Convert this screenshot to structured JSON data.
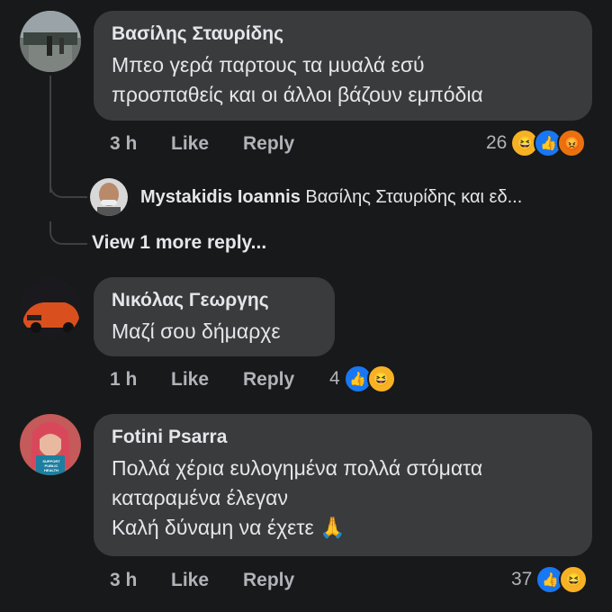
{
  "comments": [
    {
      "author": "Βασίλης Σταυρίδης",
      "text": "Μπεο γερά παρτους τα μυαλά  εσύ\nπροσπαθείς και οι άλλοι βάζουν εμπόδια",
      "time": "3 h",
      "like_label": "Like",
      "reply_label": "Reply",
      "reaction_count": "26",
      "reactions": [
        "haha-icon",
        "like-icon",
        "angry-icon"
      ]
    },
    {
      "author": "Νικόλας Γεωργης",
      "text": "Μαζί σου δήμαρχε",
      "time": "1 h",
      "like_label": "Like",
      "reply_label": "Reply",
      "reaction_count": "4",
      "reactions": [
        "like-icon",
        "haha-icon"
      ]
    },
    {
      "author": "Fotini Psarra",
      "text": "Πολλά χέρια ευλογημένα πολλά στόματα\nκαταραμένα έλεγαν\nΚαλή δύναμη να έχετε 🙏",
      "time": "3 h",
      "like_label": "Like",
      "reply_label": "Reply",
      "reaction_count": "37",
      "reactions": [
        "like-icon",
        "haha-icon"
      ],
      "avatar_text": "SUPPORT PUBLIC HEALTH"
    }
  ],
  "reply_preview": {
    "author": "Mystakidis Ioannis",
    "text": "Βασίλης Σταυρίδης και εδ..."
  },
  "view_more": "View 1 more reply...",
  "colors": {
    "background": "#18191a",
    "bubble": "#3a3b3c",
    "primary_text": "#e4e6eb",
    "secondary_text": "#b0b3b8",
    "like_blue": "#1877f2",
    "haha_yellow": "#f7b125"
  }
}
